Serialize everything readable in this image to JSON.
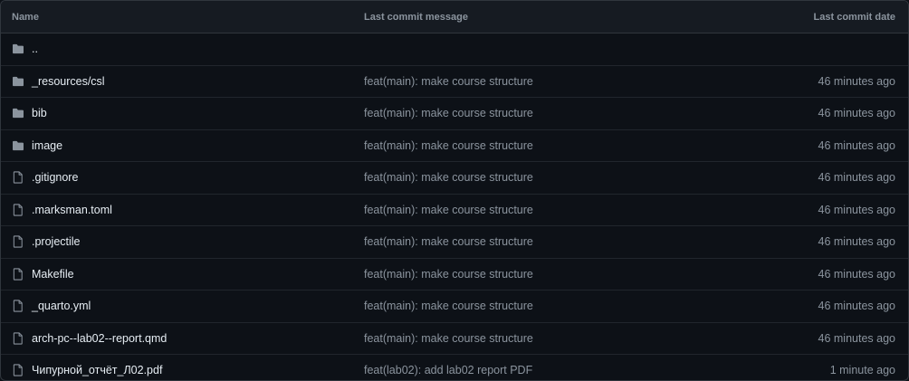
{
  "header": {
    "name": "Name",
    "message": "Last commit message",
    "date": "Last commit date"
  },
  "rows": [
    {
      "type": "folder",
      "name": "..",
      "message": "",
      "date": ""
    },
    {
      "type": "folder",
      "name": "_resources/csl",
      "message": "feat(main): make course structure",
      "date": "46 minutes ago"
    },
    {
      "type": "folder",
      "name": "bib",
      "message": "feat(main): make course structure",
      "date": "46 minutes ago"
    },
    {
      "type": "folder",
      "name": "image",
      "message": "feat(main): make course structure",
      "date": "46 minutes ago"
    },
    {
      "type": "file",
      "name": ".gitignore",
      "message": "feat(main): make course structure",
      "date": "46 minutes ago"
    },
    {
      "type": "file",
      "name": ".marksman.toml",
      "message": "feat(main): make course structure",
      "date": "46 minutes ago"
    },
    {
      "type": "file",
      "name": ".projectile",
      "message": "feat(main): make course structure",
      "date": "46 minutes ago"
    },
    {
      "type": "file",
      "name": "Makefile",
      "message": "feat(main): make course structure",
      "date": "46 minutes ago"
    },
    {
      "type": "file",
      "name": "_quarto.yml",
      "message": "feat(main): make course structure",
      "date": "46 minutes ago"
    },
    {
      "type": "file",
      "name": "arch-pc--lab02--report.qmd",
      "message": "feat(main): make course structure",
      "date": "46 minutes ago"
    },
    {
      "type": "file",
      "name": "Чипурной_отчёт_Л02.pdf",
      "message": "feat(lab02): add lab02 report PDF",
      "date": "1 minute ago"
    }
  ],
  "icons": {
    "folder": "folder-icon",
    "file": "file-icon"
  },
  "colors": {
    "background": "#0d1117",
    "header_bg": "#161b22",
    "border": "#30363d",
    "text": "#e6edf3",
    "muted": "#8b949e"
  }
}
